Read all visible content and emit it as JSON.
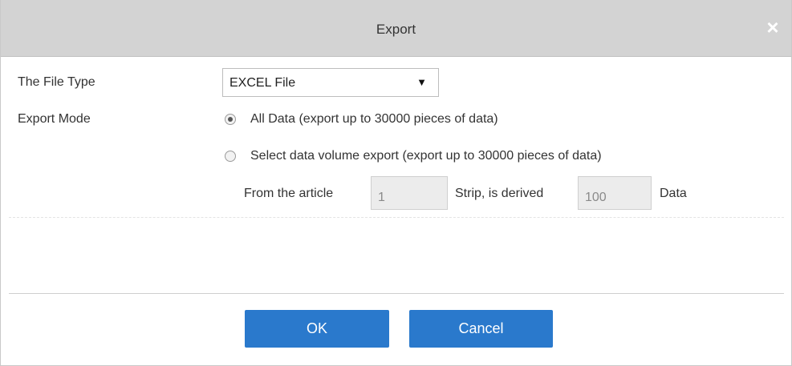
{
  "dialog": {
    "title": "Export",
    "close_glyph": "×"
  },
  "file_type": {
    "label": "The File Type",
    "selected": "EXCEL File",
    "arrow_glyph": "▼"
  },
  "export_mode": {
    "label": "Export Mode",
    "options": [
      {
        "label": "All Data (export up to 30000 pieces of data)",
        "checked": true
      },
      {
        "label": "Select data volume export (export up to 30000 pieces of data)",
        "checked": false
      }
    ],
    "range": {
      "from_label": "From the article",
      "from_value": "1",
      "strip_label": "Strip, is derived",
      "count_value": "100",
      "data_label": "Data"
    }
  },
  "buttons": {
    "ok": "OK",
    "cancel": "Cancel"
  },
  "colors": {
    "titlebar": "#d3d3d3",
    "primary_button": "#2a79cc"
  }
}
